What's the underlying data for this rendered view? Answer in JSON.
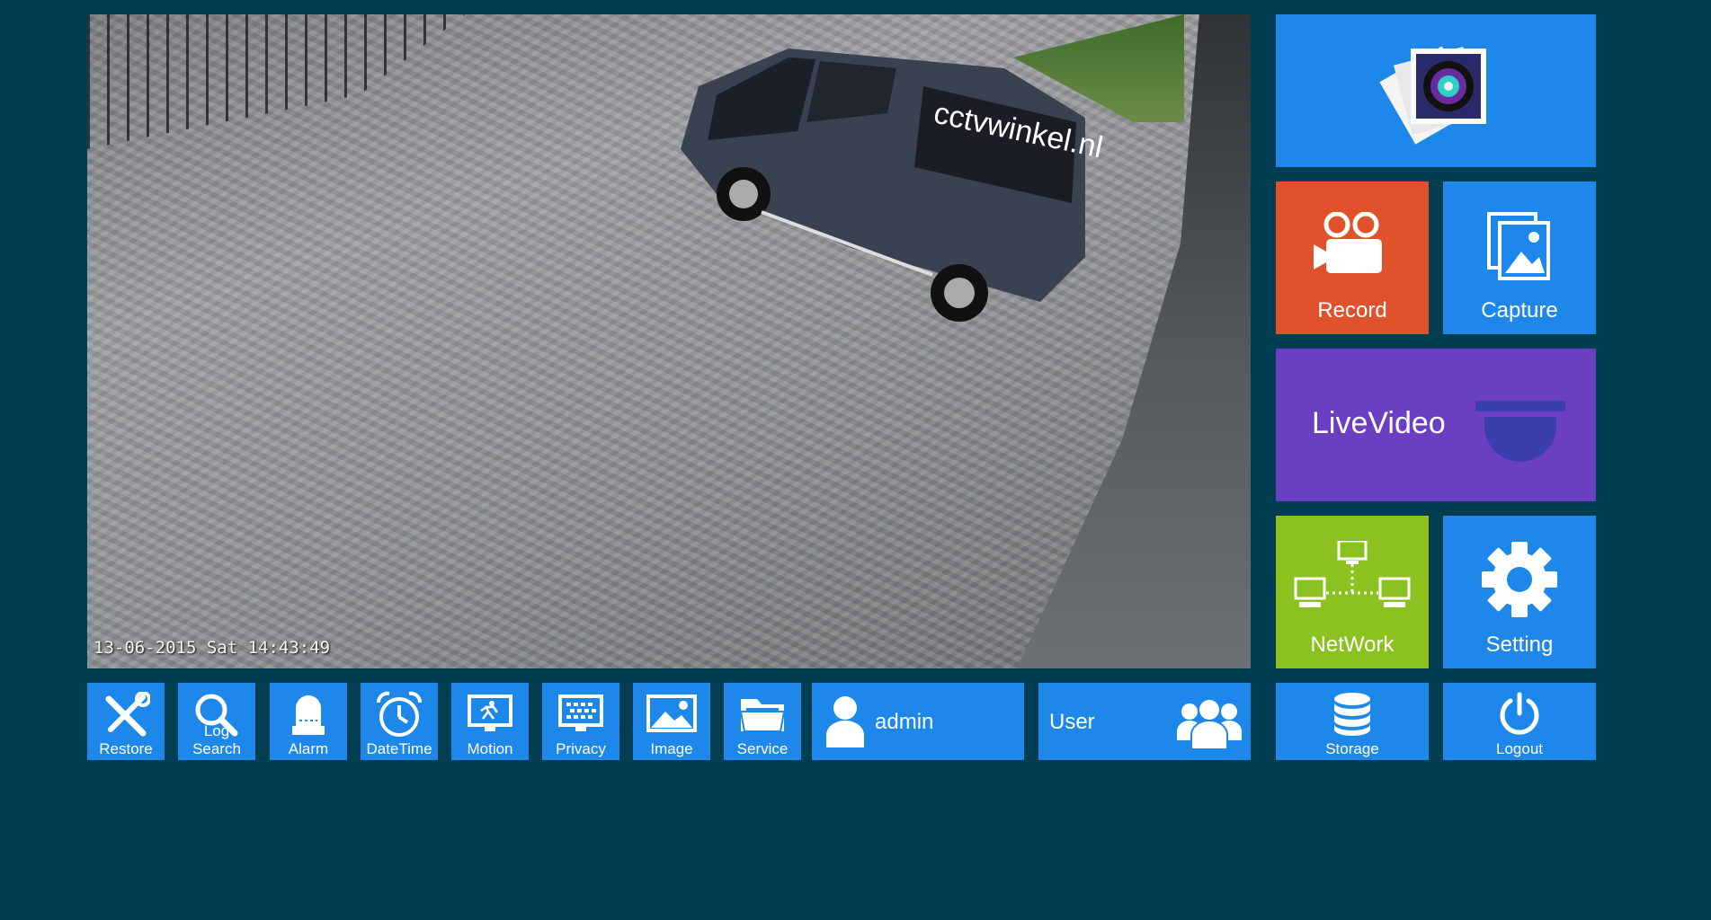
{
  "video": {
    "timestamp": "13-06-2015 Sat 14:43:49",
    "van_brand": "cctvwinkel.nl"
  },
  "colors": {
    "background": "#013e52",
    "tile_blue": "#1e88ea",
    "record_orange": "#e0522b",
    "livevideo_purple": "#6a3fc2",
    "network_green": "#8cc21f"
  },
  "tiles": {
    "photos": {
      "icon": "photo-stack-icon"
    },
    "record": {
      "label": "Record",
      "icon": "video-camera-icon"
    },
    "capture": {
      "label": "Capture",
      "icon": "picture-frame-icon"
    },
    "livevideo": {
      "label": "LiveVideo",
      "icon": "dome-camera-icon"
    },
    "network": {
      "label": "NetWork",
      "icon": "network-icon"
    },
    "setting": {
      "label": "Setting",
      "icon": "gear-icon"
    }
  },
  "toolbar": {
    "restore": "Restore",
    "log_search": "Log Search",
    "alarm": "Alarm",
    "datetime": "DateTime",
    "motion": "Motion",
    "privacy": "Privacy",
    "image": "Image",
    "service": "Service",
    "admin": "admin",
    "user": "User",
    "storage": "Storage",
    "logout": "Logout"
  }
}
